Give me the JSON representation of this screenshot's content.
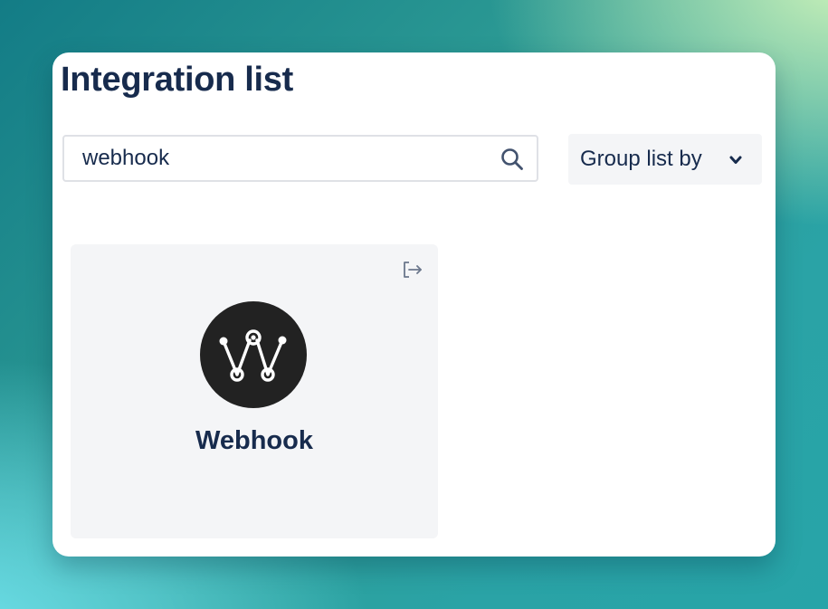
{
  "page": {
    "title": "Integration list"
  },
  "search": {
    "value": "webhook",
    "icon": "search-icon"
  },
  "group_by": {
    "label": "Group list by",
    "icon": "chevron-down-icon"
  },
  "results": [
    {
      "name": "Webhook",
      "logo": "webhook-logo",
      "action_icon": "external-link-icon"
    }
  ],
  "colors": {
    "text_primary": "#172b4d",
    "card_background": "#f4f5f7",
    "input_border": "#dfe1e6",
    "logo_background": "#222222"
  }
}
